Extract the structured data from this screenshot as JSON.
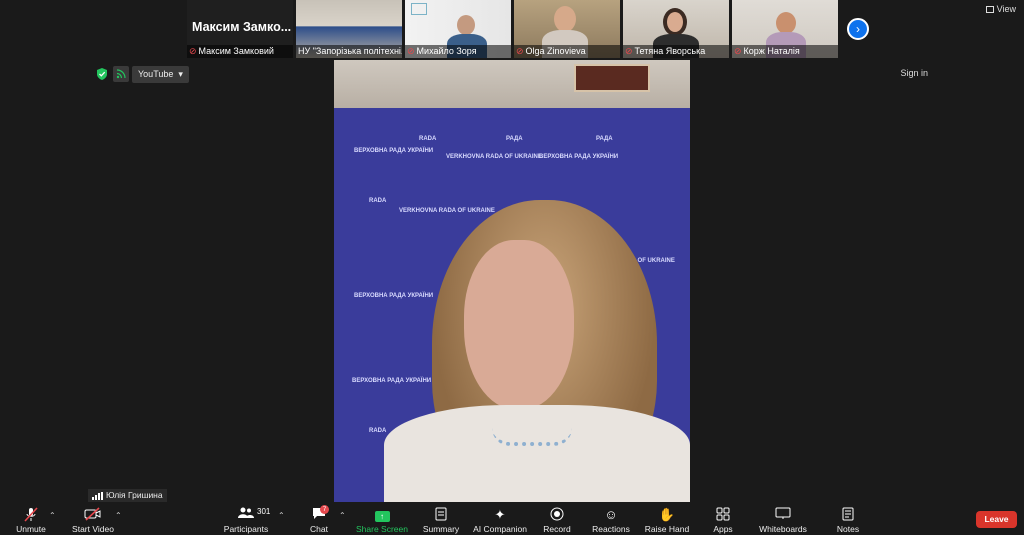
{
  "thumbnails": [
    {
      "label": "Максим Замковий",
      "big_name": "Максим Замко...",
      "muted": true
    },
    {
      "label": "НУ \"Запорізька політехні...",
      "muted": false
    },
    {
      "label": "Михайло Зоря",
      "muted": true
    },
    {
      "label": "Olga Zinovieva",
      "muted": true
    },
    {
      "label": "Тетяна Яворська",
      "muted": true
    },
    {
      "label": "Корж Наталія",
      "muted": true
    }
  ],
  "top_controls": {
    "view_label": "View",
    "stream_label": "YouTube",
    "signin_label": "Sign in"
  },
  "video": {
    "banner_text_ua": "ВЕРХОВНА РАДА УКРАЇНИ",
    "banner_text_en": "VERKHOVNA RADA OF UKRAINE",
    "banner_logo": "РАДА",
    "banner_logo_en": "RADA"
  },
  "speaker": {
    "name": "Юлія Гришина"
  },
  "toolbar": {
    "unmute": "Unmute",
    "start_video": "Start Video",
    "participants": "Participants",
    "participants_count": "301",
    "chat": "Chat",
    "chat_badge": "7",
    "share_screen": "Share Screen",
    "summary": "Summary",
    "ai_companion": "AI Companion",
    "record": "Record",
    "reactions": "Reactions",
    "raise_hand": "Raise Hand",
    "apps": "Apps",
    "whiteboards": "Whiteboards",
    "notes": "Notes",
    "leave": "Leave"
  },
  "colors": {
    "accent": "#0e72ed",
    "leave": "#d9352b",
    "share": "#23c55e",
    "muted": "#e5484d"
  }
}
